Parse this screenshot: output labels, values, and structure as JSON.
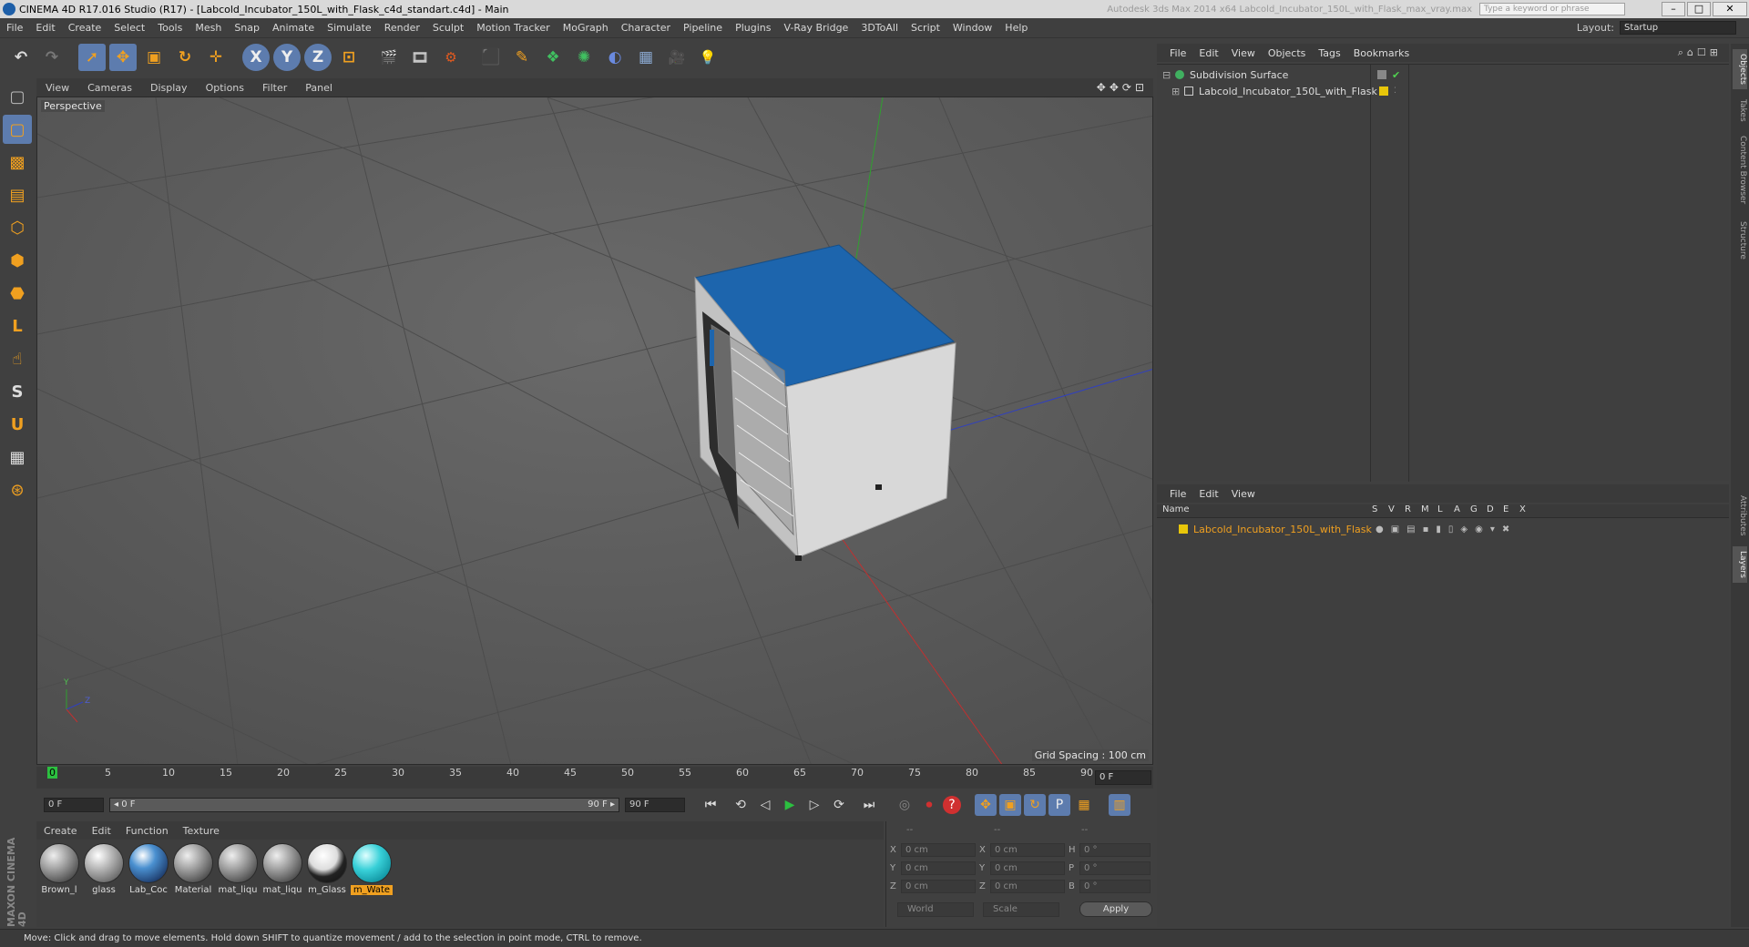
{
  "window": {
    "title": "CINEMA 4D R17.016 Studio (R17) - [Labcold_Incubator_150L_with_Flask_c4d_standart.c4d] - Main",
    "ghost_text": "Autodesk 3ds Max 2014 x64     Labcold_Incubator_150L_with_Flask_max_vray.max",
    "search_placeholder": "Type a keyword or phrase",
    "minimize": "–",
    "maximize": "□",
    "close": "✕"
  },
  "menubar": {
    "items": [
      "File",
      "Edit",
      "Create",
      "Select",
      "Tools",
      "Mesh",
      "Snap",
      "Animate",
      "Simulate",
      "Render",
      "Sculpt",
      "Motion Tracker",
      "MoGraph",
      "Character",
      "Pipeline",
      "Plugins",
      "V-Ray Bridge",
      "3DToAll",
      "Script",
      "Window",
      "Help"
    ],
    "layout_label": "Layout:",
    "layout_value": "Startup"
  },
  "toolbar": {
    "undo": "↶",
    "redo": "↷",
    "select": "➚",
    "move": "✥",
    "scale": "▣",
    "rotate": "↻",
    "last_tool": "✛",
    "x_axis": "X",
    "y_axis": "Y",
    "z_axis": "Z",
    "coord_system": "⊡",
    "render_view": "🎬",
    "render_pic": "🎞",
    "render_settings": "⚙",
    "cube": "⬛",
    "pen": "✎",
    "subdivision": "❖",
    "cloner": "✺",
    "deformer": "◐",
    "floor": "▦",
    "camera": "🎥",
    "light": "💡"
  },
  "left_toolbar": {
    "model": "▢",
    "texture": "▩",
    "workplane": "▤",
    "points": "⬡",
    "edges": "⬢",
    "polygons": "⬣",
    "axis": "L",
    "tweak": "☝",
    "solo": "S",
    "magnet": "U",
    "snap": "▦",
    "snap2": "⊛"
  },
  "viewport": {
    "menu": [
      "View",
      "Cameras",
      "Display",
      "Options",
      "Filter",
      "Panel"
    ],
    "nav_icons": "✥✥⟳⊡",
    "label": "Perspective",
    "grid_spacing": "Grid Spacing : 100 cm",
    "axis_y": "Y",
    "axis_z": "Z",
    "axis_x": "X"
  },
  "timeline": {
    "ticks": [
      "0",
      "5",
      "10",
      "15",
      "20",
      "25",
      "30",
      "35",
      "40",
      "45",
      "50",
      "55",
      "60",
      "65",
      "70",
      "75",
      "80",
      "85",
      "90"
    ],
    "current_frame": "0 F",
    "start_field": "0 F",
    "range_start": "◂ 0 F",
    "range_end": "90 F ▸",
    "end_field": "90 F"
  },
  "transport": {
    "go_start": "⏮",
    "prev_key": "⟲",
    "prev_frame": "◁",
    "play": "▶",
    "next_frame": "▷",
    "next_key": "⟳",
    "go_end": "⏭",
    "record_motion": "◎",
    "autokey": "⏺",
    "key_question": "?",
    "key_move": "✥",
    "key_scale": "▣",
    "key_rotate": "↻",
    "key_param": "P",
    "key_pla": "▦",
    "timeline_btn": "▥"
  },
  "materials": {
    "menu": [
      "Create",
      "Edit",
      "Function",
      "Texture"
    ],
    "items": [
      "Brown_l",
      "glass",
      "Lab_Coc",
      "Material",
      "mat_liqu",
      "mat_liqu",
      "m_Glass",
      "m_Wate"
    ]
  },
  "coords": {
    "header": [
      "--",
      "--",
      "--"
    ],
    "rows": [
      {
        "a": "X",
        "av": "0 cm",
        "b": "X",
        "bv": "0 cm",
        "c": "H",
        "cv": "0 °"
      },
      {
        "a": "Y",
        "av": "0 cm",
        "b": "Y",
        "bv": "0 cm",
        "c": "P",
        "cv": "0 °"
      },
      {
        "a": "Z",
        "av": "0 cm",
        "b": "Z",
        "bv": "0 cm",
        "c": "B",
        "cv": "0 °"
      }
    ],
    "world": "World",
    "scale": "Scale",
    "apply": "Apply"
  },
  "status": "Move: Click and drag to move elements. Hold down SHIFT to quantize movement / add to the selection in point mode, CTRL to remove.",
  "maxon_logo": "MAXON CINEMA 4D",
  "object_manager": {
    "menu": [
      "File",
      "Edit",
      "View",
      "Objects",
      "Tags",
      "Bookmarks"
    ],
    "icons": "⌕⌂☐⊞",
    "objects": [
      {
        "name": "Subdivision Surface",
        "check": "✔"
      },
      {
        "name": "Labcold_Incubator_150L_with_Flask",
        "check": ""
      }
    ]
  },
  "layer_manager": {
    "menu": [
      "File",
      "Edit",
      "View"
    ],
    "headers": [
      "Name",
      "S",
      "V",
      "R",
      "M",
      "L",
      "A",
      "G",
      "D",
      "E",
      "X"
    ],
    "layers": [
      {
        "name": "Labcold_Incubator_150L_with_Flask",
        "color": "#e8c60a"
      }
    ]
  },
  "right_tabs": [
    "Objects",
    "Takes",
    "Content Browser",
    "Structure",
    "Attributes",
    "Layers"
  ],
  "colors": {
    "accent": "#5d7cae",
    "layer_highlight": "#f0a020",
    "incubator_top": "#1d65ad",
    "axis_x": "#c03030",
    "axis_y": "#30a030",
    "axis_z": "#3040c0"
  }
}
